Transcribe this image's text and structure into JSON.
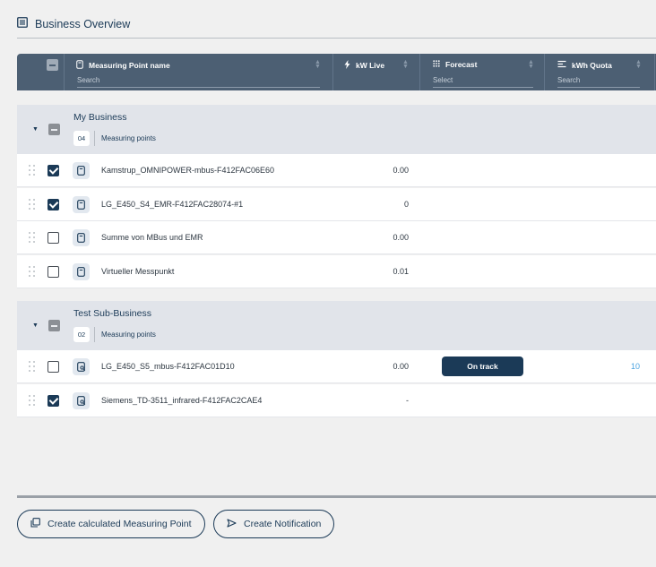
{
  "page": {
    "title": "Business Overview"
  },
  "table": {
    "columns": [
      {
        "label": "Measuring Point name",
        "sub": "Search"
      },
      {
        "label": "kW Live",
        "sub": ""
      },
      {
        "label": "Forecast",
        "sub": "Select"
      },
      {
        "label": "kWh Quota",
        "sub": "Search"
      }
    ]
  },
  "groups": [
    {
      "name": "My Business",
      "count": "04",
      "count_label": "Measuring points",
      "rows": [
        {
          "name": "Kamstrup_OMNIPOWER-mbus-F412FAC06E60",
          "kw": "0.00",
          "checked": true
        },
        {
          "name": "LG_E450_S4_EMR-F412FAC28074-#1",
          "kw": "0",
          "checked": true
        },
        {
          "name": "Summe von MBus und EMR",
          "kw": "0.00",
          "checked": false
        },
        {
          "name": "Virtueller Messpunkt",
          "kw": "0.01",
          "checked": false
        }
      ]
    },
    {
      "name": "Test Sub-Business",
      "count": "02",
      "count_label": "Measuring points",
      "rows": [
        {
          "name": "LG_E450_S5_mbus-F412FAC01D10",
          "kw": "0.00",
          "checked": false,
          "forecast": "On track",
          "quota": "10"
        },
        {
          "name": "Siemens_TD-3511_infrared-F412FAC2CAE4",
          "kw": "-",
          "checked": true
        }
      ]
    }
  ],
  "actions": {
    "create_calculated": "Create calculated Measuring Point",
    "create_notification": "Create Notification"
  }
}
